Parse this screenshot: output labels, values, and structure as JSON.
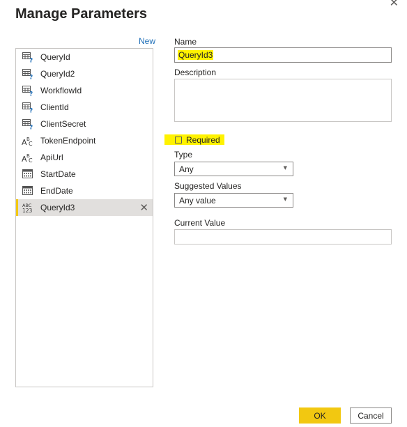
{
  "dialog": {
    "title": "Manage Parameters",
    "close_glyph": "✕",
    "new_label": "New"
  },
  "parameters": [
    {
      "name": "QueryId",
      "icon": "parameter-any-icon"
    },
    {
      "name": "QueryId2",
      "icon": "parameter-any-icon"
    },
    {
      "name": "WorkflowId",
      "icon": "parameter-any-icon"
    },
    {
      "name": "ClientId",
      "icon": "parameter-any-icon"
    },
    {
      "name": "ClientSecret",
      "icon": "parameter-any-icon"
    },
    {
      "name": "TokenEndpoint",
      "icon": "text-type-icon"
    },
    {
      "name": "ApiUrl",
      "icon": "text-type-icon"
    },
    {
      "name": "StartDate",
      "icon": "date-type-icon"
    },
    {
      "name": "EndDate",
      "icon": "date-type-icon"
    },
    {
      "name": "QueryId3",
      "icon": "any-type-icon",
      "selected": true
    }
  ],
  "form": {
    "name_label": "Name",
    "name_value": "QueryId3",
    "description_label": "Description",
    "description_value": "",
    "required_label": "Required",
    "type_label": "Type",
    "type_value": "Any",
    "suggested_label": "Suggested Values",
    "suggested_value": "Any value",
    "current_label": "Current Value",
    "current_value": ""
  },
  "buttons": {
    "ok": "OK",
    "cancel": "Cancel"
  },
  "colors": {
    "accent_yellow": "#f2c811",
    "highlight": "#fff200",
    "link_blue": "#1f6fb8",
    "selected_bg": "#e1dfdd"
  }
}
